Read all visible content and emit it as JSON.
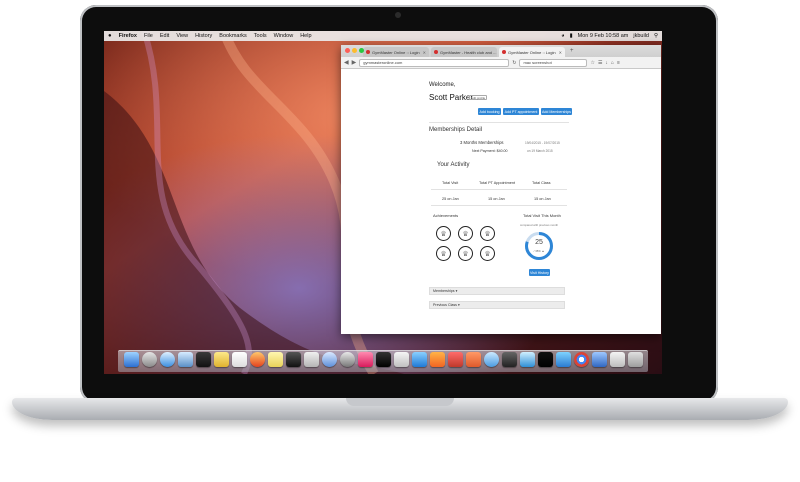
{
  "menubar": {
    "apple": "",
    "app": "Firefox",
    "items": [
      "File",
      "Edit",
      "View",
      "History",
      "Bookmarks",
      "Tools",
      "Window",
      "Help"
    ],
    "clock": "Mon 9 Feb  10:58 am",
    "user": "jkbuild"
  },
  "browser": {
    "tabs": [
      {
        "label": "GymMaster Online :: Login"
      },
      {
        "label": "GymMaster - Health club and ..."
      },
      {
        "label": "GymMaster Online :: Login"
      }
    ],
    "url": "gymmasteronline.com",
    "search_value": "mac screenshot"
  },
  "page": {
    "welcome": "Welcome,",
    "member_name": "Scott Parker",
    "edit_badge": "Edit profile",
    "actions": [
      "Add booking",
      "Add PT appointment",
      "Add Memberships"
    ],
    "memberships_heading": "Memberships Detail",
    "membership_name": "3 Months Memberships",
    "membership_dates": "19/04/2015 - 19/07/2015",
    "next_payment": "Next Payment: $40.00",
    "next_payment_date": "on 19 March 2015",
    "activity_heading": "Your Activity",
    "stats": [
      {
        "label": "Total Visit",
        "value": "25 on Jan"
      },
      {
        "label": "Total PT Appointment",
        "value": "15 on Jan"
      },
      {
        "label": "Total Class",
        "value": "15 on Jan"
      }
    ],
    "achievements_heading": "Achievements",
    "visit_month_heading": "Total Visit This Month",
    "visit_compare": "compared with previous month",
    "gauge_value": "25",
    "gauge_sub": "/ 35% ▲",
    "visit_history_button": "Visit History",
    "accordion_memberships": "Memberships ▾",
    "accordion_previous": "Previous Class ▾"
  },
  "colors": {
    "primary": "#2e86d6",
    "gauge_track": "#c9dcef"
  },
  "icons": [
    "apple-icon",
    "trophy-icon",
    "back-icon",
    "forward-icon",
    "reload-icon",
    "home-icon"
  ]
}
